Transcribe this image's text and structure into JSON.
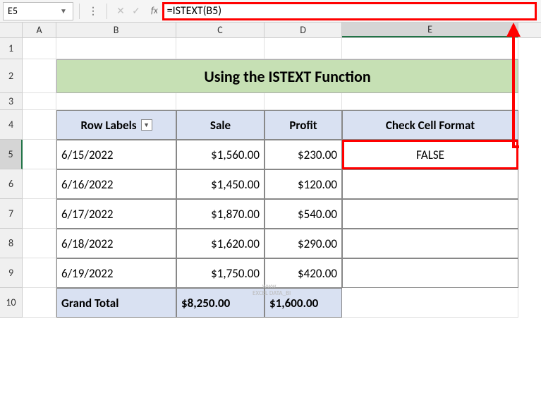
{
  "name_box": "E5",
  "fx_label": "fx",
  "formula": "=ISTEXT(B5)",
  "cols": {
    "A": "A",
    "B": "B",
    "C": "C",
    "D": "D",
    "E": "E"
  },
  "rows": {
    "1": "1",
    "2": "2",
    "3": "3",
    "4": "4",
    "5": "5",
    "6": "6",
    "7": "7",
    "8": "8",
    "9": "9",
    "10": "10"
  },
  "title": "Using the ISTEXT Function",
  "headers": {
    "b": "Row Labels",
    "c": "Sale",
    "d": "Profit",
    "e": "Check Cell Format"
  },
  "data": [
    {
      "b": "6/15/2022",
      "c": "$1,560.00",
      "d": "$230.00",
      "e": "FALSE"
    },
    {
      "b": "6/16/2022",
      "c": "$1,450.00",
      "d": "$120.00",
      "e": ""
    },
    {
      "b": "6/17/2022",
      "c": "$1,870.00",
      "d": "$540.00",
      "e": ""
    },
    {
      "b": "6/18/2022",
      "c": "$1,620.00",
      "d": "$290.00",
      "e": ""
    },
    {
      "b": "6/19/2022",
      "c": "$1,750.00",
      "d": "$420.00",
      "e": ""
    }
  ],
  "total": {
    "b": "Grand Total",
    "c": "$8,250.00",
    "d": "$1,600.00"
  },
  "filter_arrow": "▼",
  "watermark1": "www",
  "watermark2": "EXCEL DATA_BI"
}
